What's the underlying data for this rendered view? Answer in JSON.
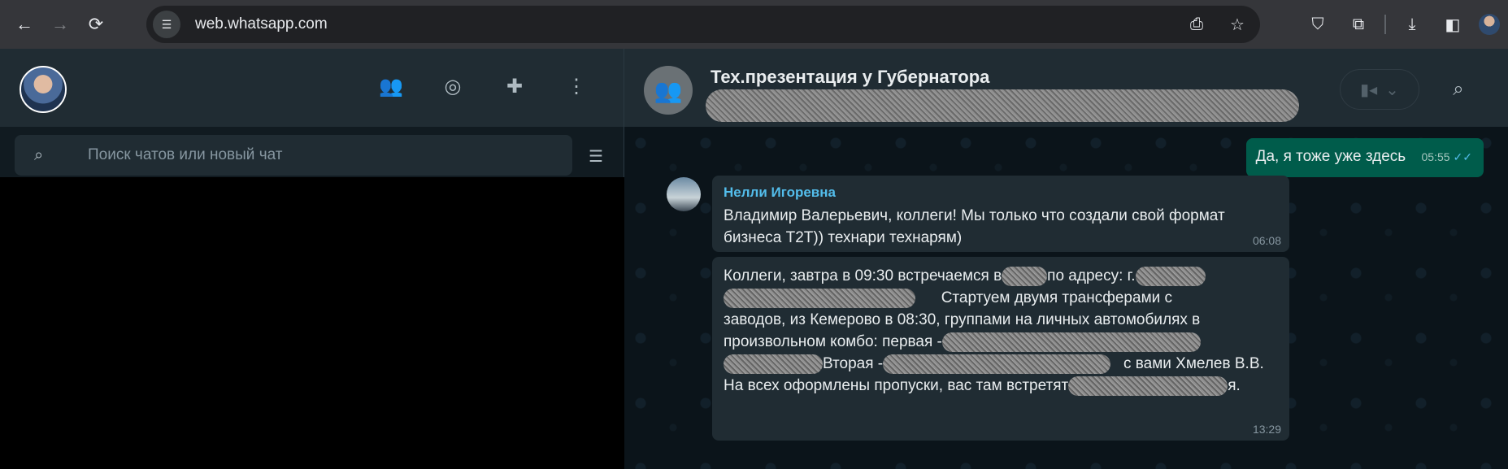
{
  "browser": {
    "url": "web.whatsapp.com"
  },
  "left_panel": {
    "search_placeholder": "Поиск чатов или новый чат"
  },
  "chat": {
    "title": "Тех.презентация у Губернатора",
    "messages": {
      "outgoing": {
        "text": "Да, я тоже уже здесь",
        "time": "05:55"
      },
      "incoming1": {
        "sender": "Нелли Игоревна",
        "line1": "Владимир Валерьевич, коллеги! Мы только что создали свой формат",
        "line2": "бизнеса Т2Т)) технари технарям)",
        "time": "06:08"
      },
      "incoming2": {
        "l1_a": "Коллеги, завтра в 09:30 встречаемся в",
        "l1_b": "по адресу: г.",
        "l2_b": "Стартуем двумя трансферами с",
        "l3": "заводов, из Кемерово в 08:30, группами на личных автомобилях в",
        "l4_a": "произвольном комбо: первая -",
        "l5_b": "Вторая -",
        "l5_c": "с вами Хмелев В.В.",
        "l6_a": "На всех оформлены пропуски, вас там встретят",
        "l6_b": "я.",
        "time": "13:29"
      }
    }
  },
  "icons": {
    "back": "arrow-left-icon",
    "forward": "arrow-right-icon",
    "reload": "reload-icon",
    "site_info": "tune-icon",
    "install": "install-app-icon",
    "bookmark": "star-icon",
    "brave": "shield-icon",
    "extensions": "puzzle-icon",
    "downloads": "download-icon",
    "sidepanel": "side-panel-icon",
    "communities": "communities-icon",
    "status": "status-icon",
    "new_chat": "new-chat-icon",
    "menu": "kebab-menu-icon",
    "search": "search-icon",
    "filter": "filter-icon",
    "video": "video-call-icon",
    "group": "group-icon"
  }
}
